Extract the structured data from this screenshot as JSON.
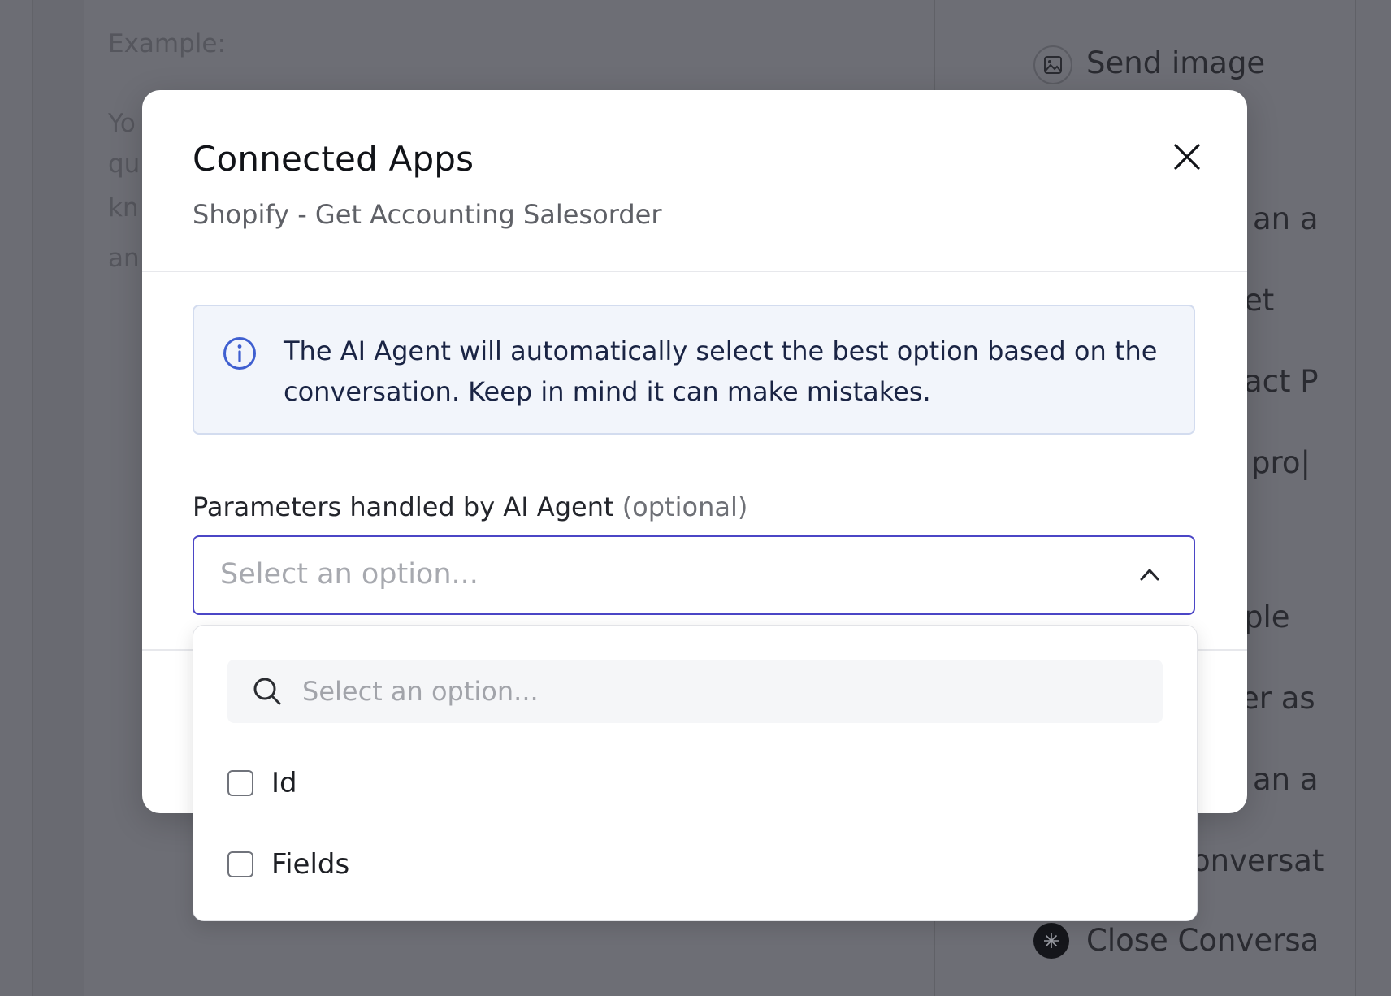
{
  "background": {
    "editor_example_label": "Example:",
    "editor_fragments": [
      "Yo",
      "qu",
      "kn",
      "an"
    ],
    "right_panel": {
      "send_image_label": "Send image",
      "fragments": [
        "an a",
        "et",
        "act P",
        "pro|",
        "ple",
        "er as",
        "an a",
        "onversat"
      ],
      "close_conversation_label": "Close Conversa"
    }
  },
  "modal": {
    "title": "Connected Apps",
    "subtitle": "Shopify - Get Accounting Salesorder",
    "info_text": "The AI Agent will automatically select the best option based on the conversation. Keep in mind it can make mistakes.",
    "field_label": "Parameters handled by AI Agent",
    "field_label_optional": "(optional)",
    "select_placeholder": "Select an option..."
  },
  "dropdown": {
    "search_placeholder": "Select an option...",
    "options": [
      {
        "label": "Id",
        "checked": false
      },
      {
        "label": "Fields",
        "checked": false
      }
    ]
  },
  "colors": {
    "accent_border": "#4b46c6",
    "info_icon": "#3f5fd0",
    "overlay": "#6c6d74"
  }
}
